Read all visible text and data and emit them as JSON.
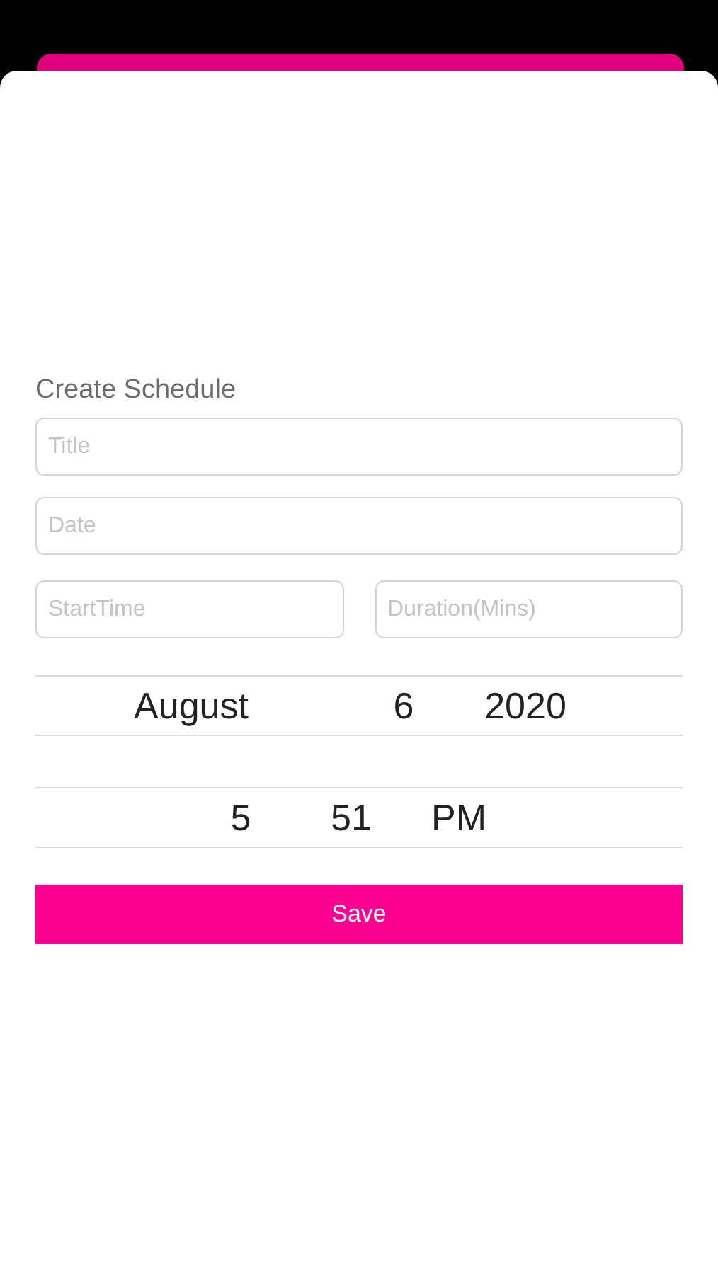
{
  "heading": "Create Schedule",
  "fields": [
    {
      "placeholder": "Title"
    },
    {
      "placeholder": "Date"
    }
  ],
  "pair_fields": [
    {
      "placeholder": "StartTime"
    },
    {
      "placeholder": "Duration(Mins)"
    }
  ],
  "date_picker": [
    "August",
    "6",
    "2020"
  ],
  "time_picker": [
    "5",
    "51",
    "PM"
  ],
  "save_button": "Save"
}
